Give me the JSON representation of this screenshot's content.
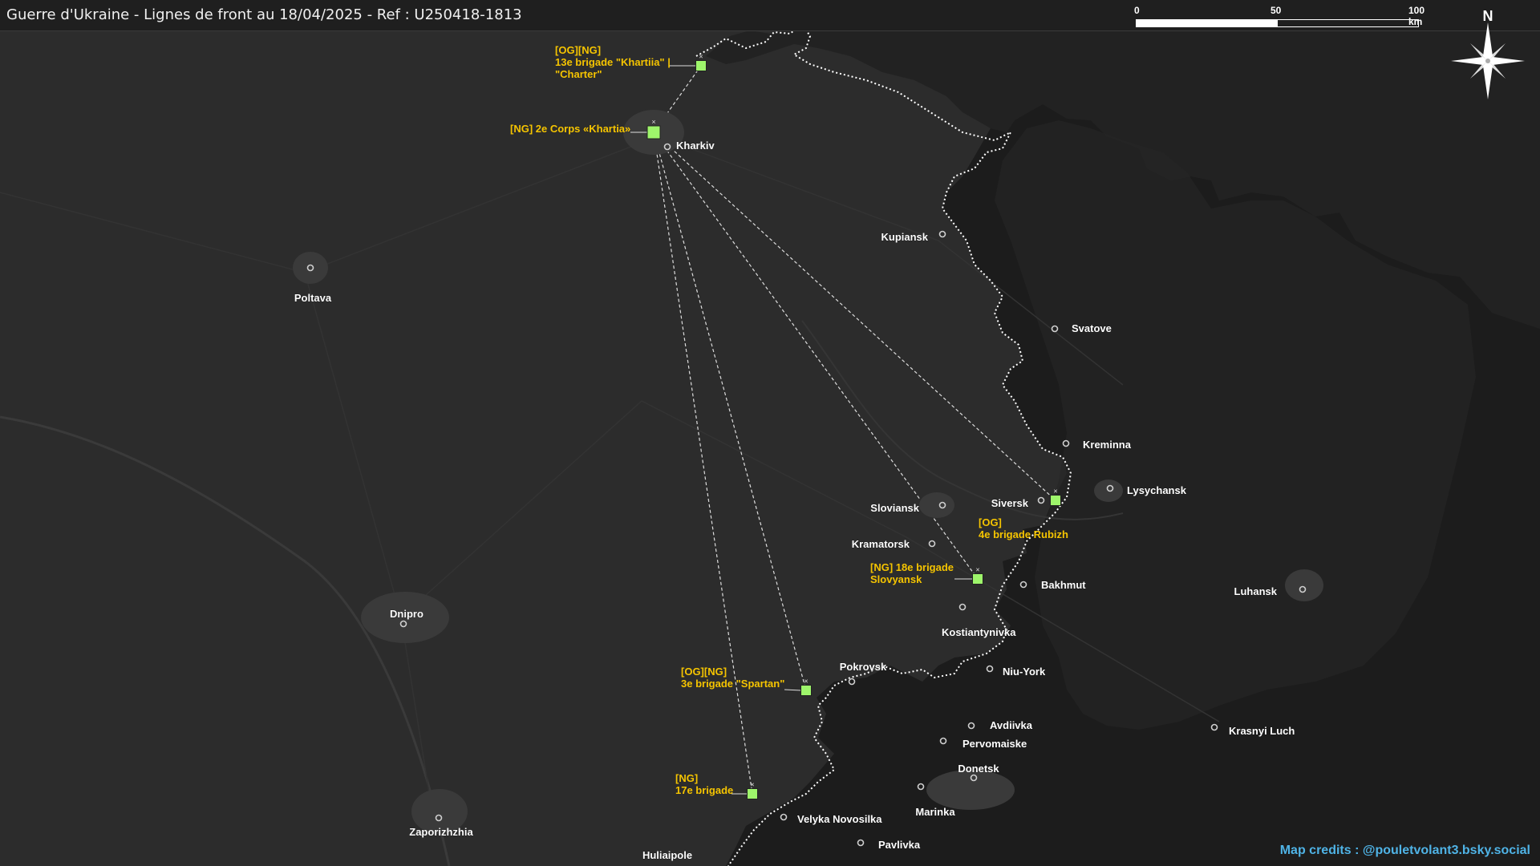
{
  "title": "Guerre d'Ukraine - Lignes de front au 18/04/2025 - Ref : U250418-1813",
  "scale": {
    "labels": [
      "0",
      "50",
      "100 km"
    ]
  },
  "compass": {
    "label": "N",
    "icon": "compass-rose-icon"
  },
  "credits": "Map credits : @pouletvolant3.bsky.social",
  "colors": {
    "background": "#2c2c2c",
    "russian_held": "#1a1a1a",
    "unit_marker": "#9ef56b",
    "unit_label": "#f5c400",
    "city_label": "#ffffff",
    "front_line": "#ffffff",
    "credits": "#4fb3e6"
  },
  "cities": [
    {
      "id": "kharkiv",
      "name": "Kharkiv"
    },
    {
      "id": "poltava",
      "name": "Poltava"
    },
    {
      "id": "kupiansk",
      "name": "Kupiansk"
    },
    {
      "id": "svatove",
      "name": "Svatove"
    },
    {
      "id": "kreminna",
      "name": "Kreminna"
    },
    {
      "id": "lysychansk",
      "name": "Lysychansk"
    },
    {
      "id": "siversk",
      "name": "Siversk"
    },
    {
      "id": "sloviansk",
      "name": "Sloviansk"
    },
    {
      "id": "kramatorsk",
      "name": "Kramatorsk"
    },
    {
      "id": "bakhmut",
      "name": "Bakhmut"
    },
    {
      "id": "luhansk",
      "name": "Luhansk"
    },
    {
      "id": "kostiantynivka",
      "name": "Kostiantynivka"
    },
    {
      "id": "dnipro",
      "name": "Dnipro"
    },
    {
      "id": "pokrovsk",
      "name": "Pokrovsk"
    },
    {
      "id": "niu-york",
      "name": "Niu-York"
    },
    {
      "id": "avdiivka",
      "name": "Avdiivka"
    },
    {
      "id": "pervomaiske",
      "name": "Pervomaiske"
    },
    {
      "id": "krasnyi-luch",
      "name": "Krasnyi Luch"
    },
    {
      "id": "donetsk",
      "name": "Donetsk"
    },
    {
      "id": "marinka",
      "name": "Marinka"
    },
    {
      "id": "velyka-novosilka",
      "name": "Velyka Novosilka"
    },
    {
      "id": "pavlivka",
      "name": "Pavlivka"
    },
    {
      "id": "zaporizhzhia",
      "name": "Zaporizhzhia"
    },
    {
      "id": "huliaipole",
      "name": "Huliaipole"
    }
  ],
  "units": [
    {
      "id": "13e-brigade",
      "lines": [
        "[OG][NG]",
        "13e brigade \"Khartiia\" |",
        "\"Charter\""
      ]
    },
    {
      "id": "2e-corps",
      "lines": [
        "[NG] 2e Corps «Khartia»"
      ]
    },
    {
      "id": "4e-brigade",
      "lines": [
        "[OG]",
        "4e brigade Rubizh"
      ]
    },
    {
      "id": "18e-brigade",
      "lines": [
        "[NG] 18e brigade",
        "Slovyansk"
      ]
    },
    {
      "id": "3e-brigade",
      "lines": [
        "[OG][NG]",
        "3e brigade \"Spartan\""
      ]
    },
    {
      "id": "17e-brigade",
      "lines": [
        "[NG]",
        "17e brigade"
      ]
    }
  ]
}
